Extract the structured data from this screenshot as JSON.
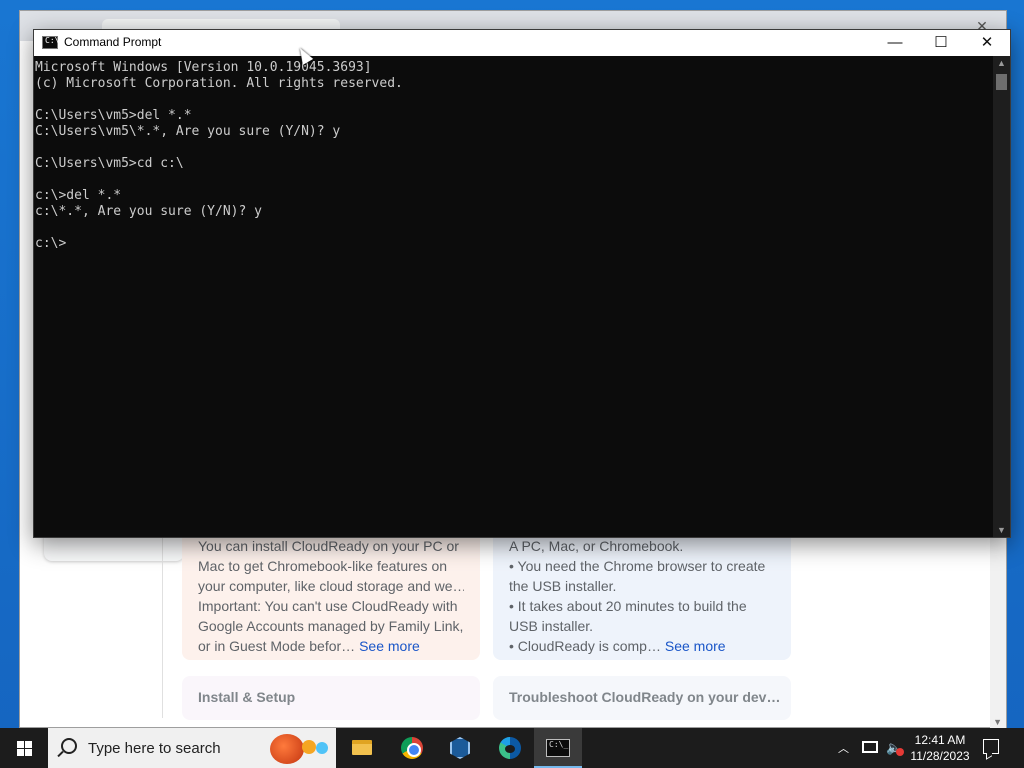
{
  "command_prompt": {
    "title": "Command Prompt",
    "controls": {
      "minimize": "—",
      "maximize": "☐",
      "close": "✕"
    },
    "lines": [
      "Microsoft Windows [Version 10.0.19045.3693]",
      "(c) Microsoft Corporation. All rights reserved.",
      "",
      "C:\\Users\\vm5>del *.*",
      "C:\\Users\\vm5\\*.*, Are you sure (Y/N)? y",
      "",
      "C:\\Users\\vm5>cd c:\\",
      "",
      "c:\\>del *.*",
      "c:\\*.*, Are you sure (Y/N)? y",
      "",
      "c:\\>"
    ]
  },
  "browser": {
    "cards": {
      "install": {
        "lines": [
          "You can install CloudReady on your PC or",
          "Mac to get Chromebook-like features on",
          "your computer, like cloud storage and we…",
          "Important: You can't use CloudReady with",
          "Google Accounts managed by Family Link,",
          "or in Guest Mode befor…"
        ],
        "see_more": "See more"
      },
      "requirements": {
        "lines": [
          "A PC, Mac, or Chromebook.",
          "• You need the Chrome browser to create",
          "the USB installer.",
          "• It takes about 20 minutes to build the",
          "USB installer.",
          "• CloudReady is comp…"
        ],
        "see_more": "See more"
      },
      "setup_title": "Install & Setup",
      "troubleshoot_title": "Troubleshoot CloudReady on your dev…"
    }
  },
  "taskbar": {
    "search_placeholder": "Type here to search",
    "clock_time": "12:41 AM",
    "clock_date": "11/28/2023",
    "pinned": [
      "file-explorer",
      "chrome",
      "virtualbox",
      "edge",
      "command-prompt"
    ]
  },
  "colors": {
    "desktop": "#1976d2",
    "console_bg": "#0c0c0c",
    "console_text": "#cccccc",
    "taskbar": "#1c1c1c",
    "link": "#1a56c8"
  }
}
